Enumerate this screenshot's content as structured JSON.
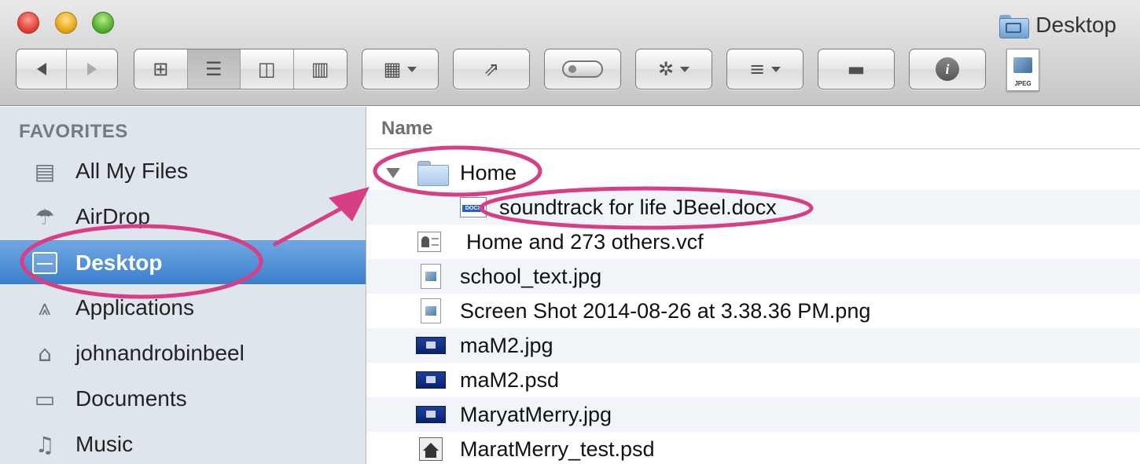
{
  "window": {
    "title": "Desktop",
    "traffic_lights": [
      "close",
      "minimize",
      "zoom"
    ]
  },
  "toolbar": {
    "buttons": [
      "back",
      "forward",
      "icon-view",
      "list-view",
      "column-view",
      "cover-flow-view",
      "arrange",
      "share",
      "tags",
      "action",
      "sort",
      "new-folder",
      "get-info"
    ],
    "preview_thumb_label": "JPEG"
  },
  "sidebar": {
    "heading": "FAVORITES",
    "items": [
      {
        "label": "All My Files",
        "icon": "all-files-icon"
      },
      {
        "label": "AirDrop",
        "icon": "airdrop-icon"
      },
      {
        "label": "Desktop",
        "icon": "desktop-icon",
        "selected": true
      },
      {
        "label": "Applications",
        "icon": "applications-icon"
      },
      {
        "label": "johnandrobinbeel",
        "icon": "home-icon"
      },
      {
        "label": "Documents",
        "icon": "documents-icon"
      },
      {
        "label": "Music",
        "icon": "music-icon"
      }
    ]
  },
  "file_list": {
    "column_header": "Name",
    "rows": [
      {
        "name": "Home",
        "icon": "folder-icon",
        "expanded": true
      },
      {
        "name": "soundtrack for life JBeel.docx",
        "icon": "docx-icon",
        "indent": 1,
        "docx_label": "DOCX"
      },
      {
        "name": "Home and 273 others.vcf",
        "icon": "vcard-icon"
      },
      {
        "name": "school_text.jpg",
        "icon": "jpg-icon"
      },
      {
        "name": "Screen Shot 2014-08-26 at 3.38.36 PM.png",
        "icon": "png-icon"
      },
      {
        "name": "maM2.jpg",
        "icon": "image-thumbnail-icon"
      },
      {
        "name": "maM2.psd",
        "icon": "image-thumbnail-icon"
      },
      {
        "name": "MaryatMerry.jpg",
        "icon": "image-thumbnail-icon"
      },
      {
        "name": "MaratMerry_test.psd",
        "icon": "psd-thumbnail-icon"
      }
    ]
  },
  "annotations": {
    "color": "#d63f86",
    "circled": [
      "Desktop",
      "Home",
      "soundtrack for life JBeel.docx"
    ]
  }
}
